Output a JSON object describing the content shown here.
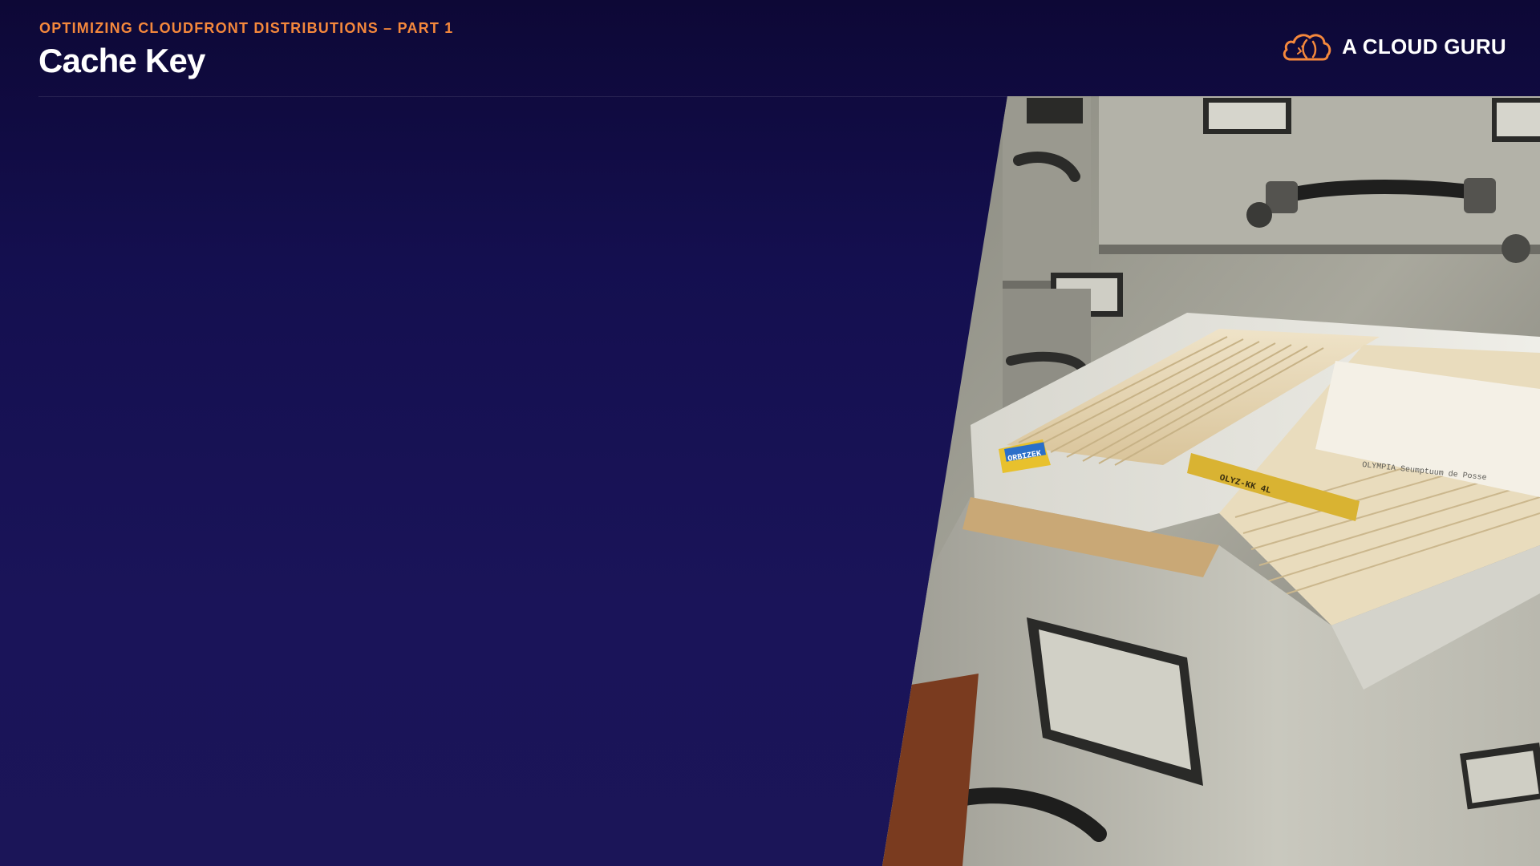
{
  "header": {
    "eyebrow": "OPTIMIZING CLOUDFRONT DISTRIBUTIONS – PART 1",
    "title": "Cache Key"
  },
  "brand": {
    "name": "A CLOUD GURU",
    "logo_icon": "cloud-logo-icon"
  },
  "photo": {
    "subject": "file-cabinet-drawer-image",
    "tab_labels": [
      "ORBIZEK",
      "OLYZ-KK 4L"
    ],
    "card_text": "OLYMPIA Seumptuum de Posse"
  },
  "colors": {
    "background": "#140f4f",
    "accent": "#f5883c",
    "title": "#ffffff"
  }
}
